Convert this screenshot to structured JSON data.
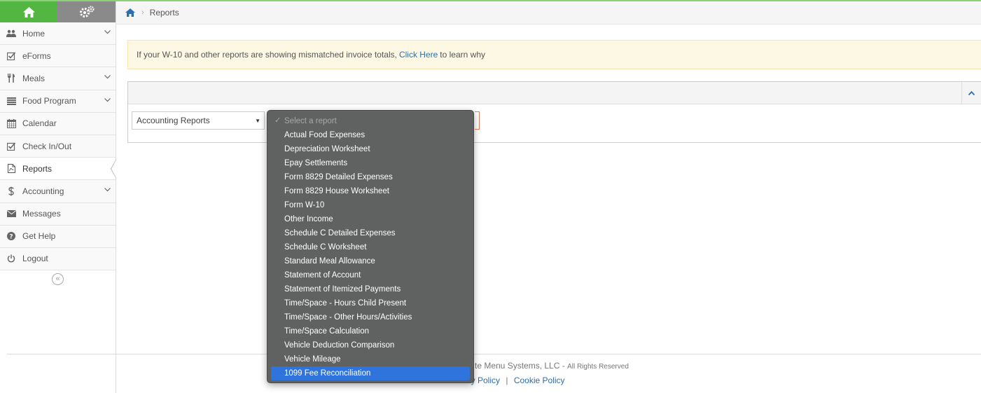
{
  "sidebar": {
    "items": [
      {
        "label": "Home",
        "icon": "users-icon",
        "has_submenu": true
      },
      {
        "label": "eForms",
        "icon": "checkbox-icon",
        "has_submenu": false
      },
      {
        "label": "Meals",
        "icon": "utensils-icon",
        "has_submenu": true
      },
      {
        "label": "Food Program",
        "icon": "list-icon",
        "has_submenu": true
      },
      {
        "label": "Calendar",
        "icon": "calendar-icon",
        "has_submenu": false
      },
      {
        "label": "Check In/Out",
        "icon": "checkbox-icon",
        "has_submenu": false
      },
      {
        "label": "Reports",
        "icon": "pdf-file-icon",
        "has_submenu": false,
        "active": true
      },
      {
        "label": "Accounting",
        "icon": "dollar-icon",
        "has_submenu": true
      },
      {
        "label": "Messages",
        "icon": "envelope-icon",
        "has_submenu": false
      },
      {
        "label": "Get Help",
        "icon": "question-icon",
        "has_submenu": false
      },
      {
        "label": "Logout",
        "icon": "power-icon",
        "has_submenu": false
      }
    ],
    "collapse_glyph": "«"
  },
  "breadcrumb": {
    "separator": "›",
    "current": "Reports"
  },
  "alert": {
    "text_before": "If your W-10 and other reports are showing mismatched invoice totals,",
    "link": "Click Here",
    "text_after": "to learn why"
  },
  "filters": {
    "category_value": "Accounting Reports",
    "category_arrow": "▼"
  },
  "report_dropdown": {
    "placeholder": "Select a report",
    "check_glyph": "✓",
    "options": [
      "Actual Food Expenses",
      "Depreciation Worksheet",
      "Epay Settlements",
      "Form 8829 Detailed Expenses",
      "Form 8829 House Worksheet",
      "Form W-10",
      "Other Income",
      "Schedule C Detailed Expenses",
      "Schedule C Worksheet",
      "Standard Meal Allowance",
      "Statement of Account",
      "Statement of Itemized Payments",
      "Time/Space - Hours Child Present",
      "Time/Space - Other Hours/Activities",
      "Time/Space Calculation",
      "Vehicle Deduction Comparison",
      "Vehicle Mileage",
      "1099 Fee Reconciliation"
    ],
    "selected": "1099 Fee Reconciliation"
  },
  "footer": {
    "copyright": "te Menu Systems, LLC -",
    "rights": "All Rights Reserved",
    "privacy_link": "vacy Policy",
    "pipe": "|",
    "cookie_link": "Cookie Policy"
  },
  "colors": {
    "brand_green": "#53b542",
    "selected_blue": "#2f73dd",
    "link_blue": "#2a6fb0",
    "alert_bg": "#fcf8e3"
  }
}
